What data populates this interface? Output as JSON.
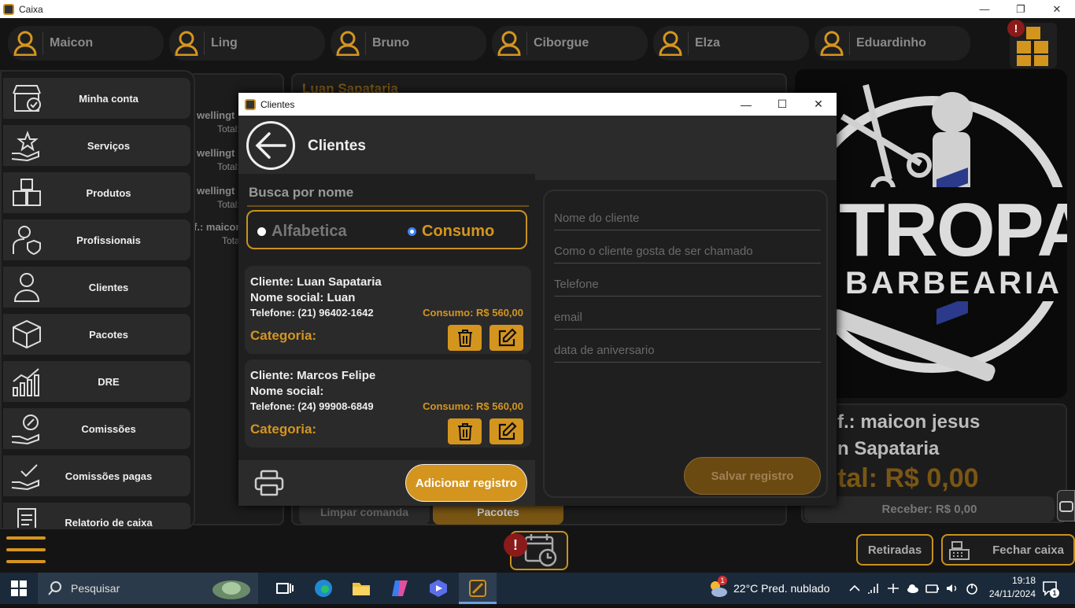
{
  "window": {
    "title": "Caixa",
    "minimize": "—",
    "maximize": "❐",
    "close": "✕"
  },
  "professionals": [
    "Maicon",
    "Ling",
    "Bruno",
    "Ciborgue",
    "Elza",
    "Eduardinho"
  ],
  "alerts": {
    "top": "!",
    "bottom": "!"
  },
  "sidebar": {
    "items": [
      {
        "label": "Minha conta",
        "icon": "store-check-icon"
      },
      {
        "label": "Serviços",
        "icon": "hand-star-icon"
      },
      {
        "label": "Produtos",
        "icon": "boxes-icon"
      },
      {
        "label": "Profissionais",
        "icon": "user-check-icon"
      },
      {
        "label": "Clientes",
        "icon": "user-icon"
      },
      {
        "label": "Pacotes",
        "icon": "package-icon"
      },
      {
        "label": "DRE",
        "icon": "chart-icon"
      },
      {
        "label": "Comissões",
        "icon": "hand-coin-icon"
      },
      {
        "label": "Comissões pagas",
        "icon": "hand-check-icon"
      },
      {
        "label": "Relatorio de caixa",
        "icon": "report-icon"
      }
    ]
  },
  "background": {
    "comanda_title": "Luan Sapataria",
    "left_list": [
      {
        "name": "wellingt",
        "total": "Total:"
      },
      {
        "name": "wellingt",
        "total": "Total:"
      },
      {
        "name": "wellingt",
        "total": "Total:"
      },
      {
        "name": "f.: maicor",
        "total": "Tota"
      }
    ],
    "limpar": "Limpar comanda",
    "pacotes": "Pacotes",
    "prof_line": "f.: maicon jesus",
    "client_line": "n Sapataria",
    "total_line": "tal: R$ 0,00",
    "receber": "Receber: R$ 0,00",
    "logo_top": "TROPA",
    "logo_bottom": "BARBEARIA",
    "retiradas": "Retiradas",
    "fechar_caixa": "Fechar caixa"
  },
  "dialog": {
    "title": "Clientes",
    "minimize": "—",
    "maximize": "☐",
    "close": "✕",
    "heading": "Clientes",
    "search_placeholder": "Busca por nome",
    "sort_options": [
      "Alfabetica",
      "Consumo"
    ],
    "sort_selected": "Consumo",
    "clients": [
      {
        "cliente": "Cliente: Luan Sapataria",
        "social": "Nome social: Luan",
        "telefone": "Telefone: (21) 96402-1642",
        "consumo": "Consumo: R$ 560,00",
        "categoria": "Categoria:"
      },
      {
        "cliente": "Cliente: Marcos Felipe",
        "social": "Nome social:",
        "telefone": "Telefone: (24) 99908-6849",
        "consumo": "Consumo: R$ 560,00",
        "categoria": "Categoria:"
      }
    ],
    "add_button": "Adicionar registro",
    "form": {
      "nome": "Nome do cliente",
      "chamado": "Como o cliente gosta de ser chamado",
      "telefone": "Telefone",
      "email": "email",
      "aniversario": "data de aniversario",
      "save": "Salvar registro"
    }
  },
  "taskbar": {
    "search": "Pesquisar",
    "weather": "22°C  Pred. nublado",
    "time": "19:18",
    "date": "24/11/2024",
    "notif_count": "1",
    "weather_badge": "1"
  },
  "colors": {
    "accent": "#d4951f",
    "bg": "#141414",
    "alert": "#8b1a1a"
  }
}
